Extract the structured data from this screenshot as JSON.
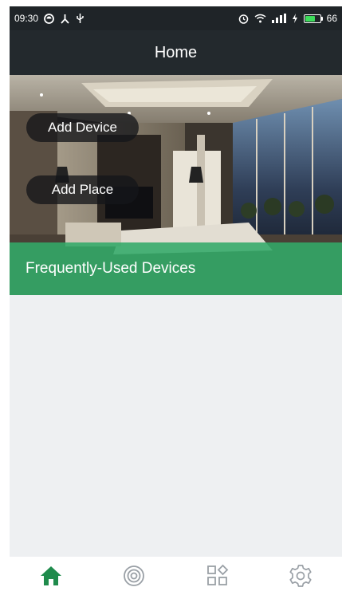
{
  "status_bar": {
    "time": "09:30",
    "battery_text": "66",
    "battery_level": 0.66,
    "icons": [
      "sync-icon",
      "share-icon",
      "usb-icon",
      "alarm-icon",
      "wifi-icon",
      "signal-icon",
      "charging-icon",
      "battery-icon"
    ]
  },
  "app_bar": {
    "title": "Home"
  },
  "hero": {
    "add_device_label": "Add Device",
    "add_place_label": "Add Place",
    "frequently_used_label": "Frequently-Used Devices"
  },
  "bottom_nav": {
    "items": [
      {
        "icon": "home-icon",
        "active": true
      },
      {
        "icon": "camera-icon",
        "active": false
      },
      {
        "icon": "apps-icon",
        "active": false
      },
      {
        "icon": "settings-icon",
        "active": false
      }
    ]
  },
  "colors": {
    "accent": "#2f9e5e",
    "status_bar": "#1f2428",
    "app_bar": "#23292d",
    "banner": "#32aa69",
    "content_bg": "#eef0f2",
    "nav_active": "#1f8b4c",
    "nav_inactive": "#9aa0a6"
  }
}
